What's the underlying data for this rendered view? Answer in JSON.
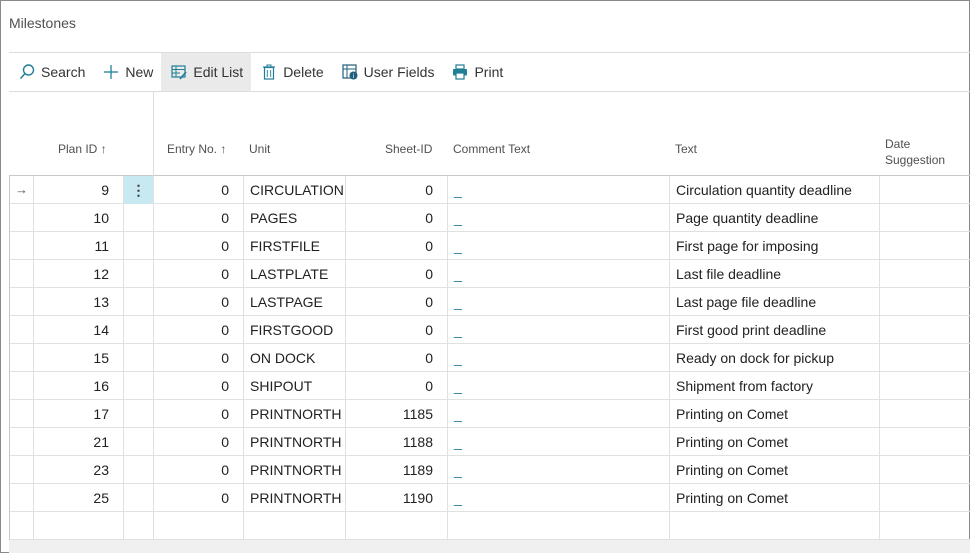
{
  "page": {
    "title": "Milestones"
  },
  "toolbar": {
    "items": [
      {
        "label": "Search",
        "icon": "search-icon"
      },
      {
        "label": "New",
        "icon": "plus-icon"
      },
      {
        "label": "Edit List",
        "icon": "edit-list-icon"
      },
      {
        "label": "Delete",
        "icon": "trash-icon"
      },
      {
        "label": "User Fields",
        "icon": "user-fields-icon"
      },
      {
        "label": "Print",
        "icon": "printer-icon"
      }
    ]
  },
  "table": {
    "headers": {
      "plan_id": "Plan ID ↑",
      "entry_no": "Entry No. ↑",
      "unit": "Unit",
      "sheet_id": "Sheet-ID",
      "comment_text": "Comment Text",
      "text": "Text",
      "date_suggestion": "Date Suggestion"
    },
    "rows": [
      {
        "plan_id": "9",
        "entry_no": "0",
        "unit": "CIRCULATION",
        "sheet_id": "0",
        "comment": "_",
        "text": "Circulation quantity deadline"
      },
      {
        "plan_id": "10",
        "entry_no": "0",
        "unit": "PAGES",
        "sheet_id": "0",
        "comment": "_",
        "text": "Page quantity deadline"
      },
      {
        "plan_id": "11",
        "entry_no": "0",
        "unit": "FIRSTFILE",
        "sheet_id": "0",
        "comment": "_",
        "text": "First page for imposing"
      },
      {
        "plan_id": "12",
        "entry_no": "0",
        "unit": "LASTPLATE",
        "sheet_id": "0",
        "comment": "_",
        "text": "Last file deadline"
      },
      {
        "plan_id": "13",
        "entry_no": "0",
        "unit": "LASTPAGE",
        "sheet_id": "0",
        "comment": "_",
        "text": "Last page file deadline"
      },
      {
        "plan_id": "14",
        "entry_no": "0",
        "unit": "FIRSTGOOD",
        "sheet_id": "0",
        "comment": "_",
        "text": "First good print deadline"
      },
      {
        "plan_id": "15",
        "entry_no": "0",
        "unit": "ON DOCK",
        "sheet_id": "0",
        "comment": "_",
        "text": "Ready on dock for pickup"
      },
      {
        "plan_id": "16",
        "entry_no": "0",
        "unit": "SHIPOUT",
        "sheet_id": "0",
        "comment": "_",
        "text": "Shipment from factory"
      },
      {
        "plan_id": "17",
        "entry_no": "0",
        "unit": "PRINTNORTH",
        "sheet_id": "1185",
        "comment": "_",
        "text": "Printing on Comet"
      },
      {
        "plan_id": "21",
        "entry_no": "0",
        "unit": "PRINTNORTH",
        "sheet_id": "1188",
        "comment": "_",
        "text": "Printing on Comet"
      },
      {
        "plan_id": "23",
        "entry_no": "0",
        "unit": "PRINTNORTH",
        "sheet_id": "1189",
        "comment": "_",
        "text": "Printing on Comet"
      },
      {
        "plan_id": "25",
        "entry_no": "0",
        "unit": "PRINTNORTH",
        "sheet_id": "1190",
        "comment": "_",
        "text": "Printing on Comet"
      }
    ],
    "row_marker": "→",
    "row_menu": "⋮"
  },
  "colors": {
    "accent": "#1f7f96",
    "selected_cell": "#c9e9f2"
  }
}
